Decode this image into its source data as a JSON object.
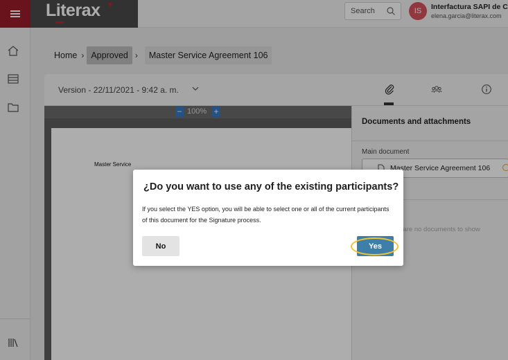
{
  "app": {
    "logo": "Literax",
    "menu_icon": "hamburger-icon",
    "brand_color": "#9b1d2a"
  },
  "search": {
    "label": "Search",
    "icon": "search-icon"
  },
  "user": {
    "initials": "IS",
    "company": "Interfactura SAPI de CV",
    "email": "elena.garcia@literax.com",
    "avatar_color": "#d9525e"
  },
  "sidebar": {
    "items": [
      {
        "icon": "home-icon"
      },
      {
        "icon": "inbox-icon"
      },
      {
        "icon": "folder-icon"
      },
      {
        "icon": "library-icon"
      }
    ]
  },
  "breadcrumb": {
    "home": "Home",
    "approved": "Approved",
    "current": "Master Service Agreement 106"
  },
  "toolbar": {
    "version": "Version - 22/11/2021 - 9:42 a. m.",
    "tabs": [
      {
        "icon": "paperclip-icon",
        "selected": true
      },
      {
        "icon": "participants-icon",
        "selected": false
      },
      {
        "icon": "info-icon",
        "selected": false
      }
    ]
  },
  "viewer": {
    "zoom": "100%",
    "zoom_out": "−",
    "zoom_in": "+",
    "page_title": "Master Service"
  },
  "documents": {
    "title": "Documents and attachments",
    "main_label": "Main document",
    "main_name": "Master Service Agreement 106",
    "empty": "There are no documents to show"
  },
  "dialog": {
    "title": "¿Do you want to use any of the existing participants?",
    "body": "If you select the YES option, you will be able to select one or all of the current participants of this document for the Signature process.",
    "no_label": "No",
    "yes_label": "Yes"
  }
}
